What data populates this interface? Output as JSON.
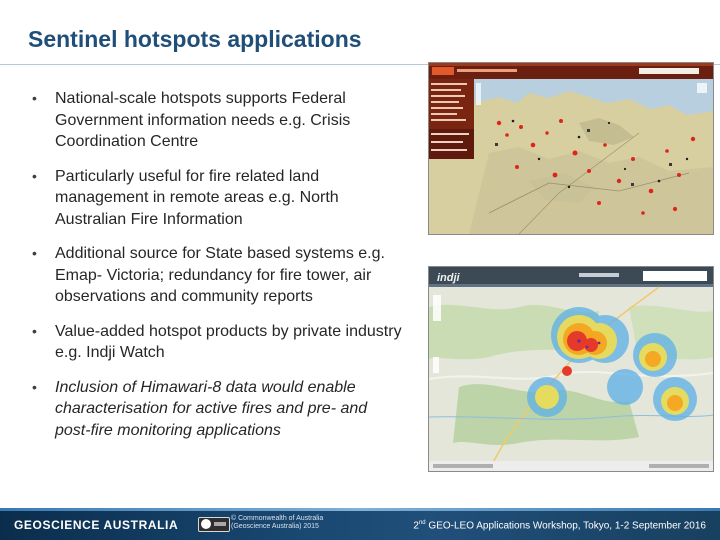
{
  "slide": {
    "title": "Sentinel hotspots applications",
    "bullets": [
      {
        "marker": "•",
        "text": "National-scale hotspots supports Federal Government information needs e.g. Crisis Coordination Centre",
        "italic": false
      },
      {
        "marker": "•",
        "text": "Particularly useful for fire related land management in remote areas e.g. North Australian Fire Information",
        "italic": false
      },
      {
        "marker": "•",
        "text": "Additional source for State based systems e.g. Emap- Victoria; redundancy for fire tower, air observations and community reports",
        "italic": false
      },
      {
        "marker": "•",
        "text": "Value-added hotspot products by private industry e.g. Indji Watch",
        "italic": false
      },
      {
        "marker": "•",
        "text": "Inclusion of Himawari-8 data would enable characterisation for active fires and pre- and post-fire monitoring applications",
        "italic": true
      }
    ]
  },
  "images": {
    "top": {
      "icon": "north-australia-fire-map-screenshot",
      "land_color": "#d7cfa0",
      "sea_color": "#b8cfe0",
      "hotspot_color": "#e0241b"
    },
    "bottom": {
      "icon": "indji-watch-map-screenshot",
      "logo_text": "indji",
      "heat_colors": [
        "#e53a2a",
        "#f6a21c",
        "#f8e04a",
        "#5db0e6"
      ]
    }
  },
  "footer": {
    "organisation": "GEOSCIENCE AUSTRALIA",
    "copyright_line1": "© Commonwealth of Australia",
    "copyright_line2": "(Geoscience Australia) 2015",
    "workshop_ordinal": "2",
    "workshop_suffix": "nd",
    "workshop_text": " GEO-LEO Applications Workshop, Tokyo, 1-2 September 2016"
  },
  "colors": {
    "title": "#1f4e79",
    "footer_bg": "#1a4a74",
    "text": "#262626"
  }
}
